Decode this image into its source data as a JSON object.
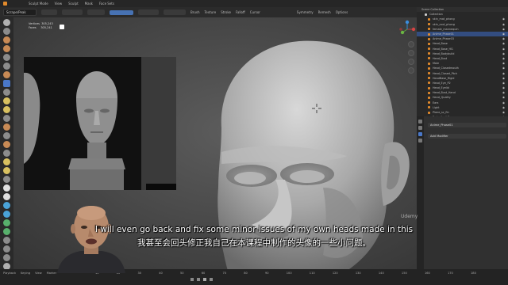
{
  "menubar": {
    "items": [
      "Sculpt Mode",
      "View",
      "Sculpt",
      "Mask",
      "Face Sets"
    ]
  },
  "header": {
    "mode_field": "Scrape/Peak",
    "buttons": [
      "Brush",
      "Texture",
      "Stroke",
      "Falloff",
      "Cursor"
    ],
    "symmetry": "Symmetry",
    "remesh": "Remesh",
    "options": "Options"
  },
  "stats": {
    "line1_label": "Vertices",
    "line1_value": "305,243",
    "line2_label": "Faces",
    "line2_value": "305,241"
  },
  "outliner": {
    "title": "Scene Collection",
    "collection": "Collection",
    "rows": [
      "skin_mat_phong",
      "skin_cool_phong",
      "female_mannequin",
      "Anime_Phase01",
      "Anime_Phase03",
      "Head_Base",
      "Head_Base_HG",
      "Head_Bodybuild",
      "Head_Bust",
      "Male",
      "Head_Closedmouth",
      "Head_Closed_Ptch",
      "HeadBase_Rigid",
      "Head_Eye_P2",
      "Head_Eyelid",
      "Head_Bust_Hand",
      "Hand_Quality",
      "Ears",
      "Light",
      "Plane_sc_fin",
      "Portrait_of_Pere",
      "Bust",
      "Head_skins"
    ],
    "selected_index": 3,
    "colors": {
      "accent": "#e38b2c",
      "selected_bg": "#334d80"
    }
  },
  "properties": {
    "object_name": "Anime_Phase01",
    "modifier_label": "Add Modifier"
  },
  "timeline": {
    "left_items": [
      "Playback",
      "Keying",
      "View",
      "Marker"
    ],
    "frame_ticks": [
      "10",
      "20",
      "30",
      "40",
      "50",
      "60",
      "70",
      "80",
      "90",
      "100",
      "110",
      "120",
      "130",
      "140",
      "150",
      "160",
      "170",
      "180"
    ]
  },
  "subtitles": {
    "en": "I will even go back and fix some minor issues of my own heads made in this",
    "zh": "我甚至会回头修正我自己在本课程中制作的头像的一些小问题。"
  },
  "watermark": "Udemy"
}
